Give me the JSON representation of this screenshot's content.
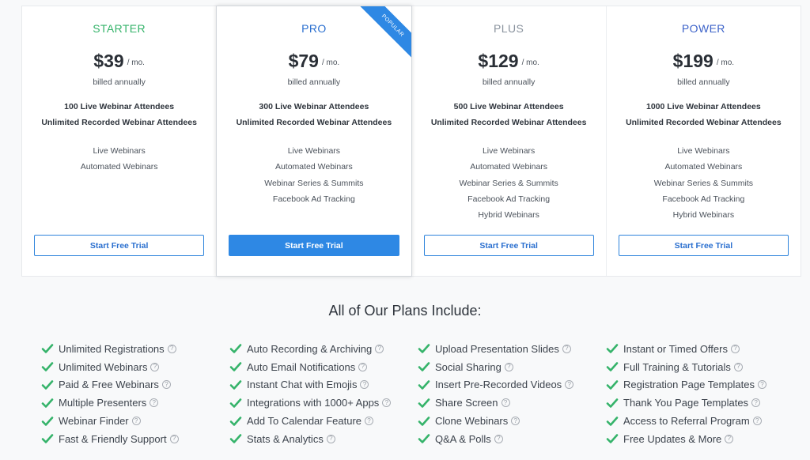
{
  "colors": {
    "accent": "#2e88e4",
    "check": "#35b36a",
    "starter": "#35b36a",
    "pro": "#2a6fcf",
    "plus": "#8a939e",
    "power": "#3d63c9"
  },
  "plans": [
    {
      "name": "STARTER",
      "price": "$39",
      "period": "/ mo.",
      "billing": "billed annually",
      "attendees": [
        "100 Live Webinar Attendees",
        "Unlimited Recorded Webinar Attendees"
      ],
      "features": [
        "Live Webinars",
        "Automated Webinars"
      ],
      "cta": "Start Free Trial"
    },
    {
      "name": "PRO",
      "badge": "POPULAR",
      "price": "$79",
      "period": "/ mo.",
      "billing": "billed annually",
      "attendees": [
        "300 Live Webinar Attendees",
        "Unlimited Recorded Webinar Attendees"
      ],
      "features": [
        "Live Webinars",
        "Automated Webinars",
        "Webinar Series & Summits",
        "Facebook Ad Tracking"
      ],
      "cta": "Start Free Trial"
    },
    {
      "name": "PLUS",
      "price": "$129",
      "period": "/ mo.",
      "billing": "billed annually",
      "attendees": [
        "500 Live Webinar Attendees",
        "Unlimited Recorded Webinar Attendees"
      ],
      "features": [
        "Live Webinars",
        "Automated Webinars",
        "Webinar Series & Summits",
        "Facebook Ad Tracking",
        "Hybrid Webinars"
      ],
      "cta": "Start Free Trial"
    },
    {
      "name": "POWER",
      "price": "$199",
      "period": "/ mo.",
      "billing": "billed annually",
      "attendees": [
        "1000 Live Webinar Attendees",
        "Unlimited Recorded Webinar Attendees"
      ],
      "features": [
        "Live Webinars",
        "Automated Webinars",
        "Webinar Series & Summits",
        "Facebook Ad Tracking",
        "Hybrid Webinars"
      ],
      "cta": "Start Free Trial"
    }
  ],
  "includes": {
    "title": "All of Our Plans Include:",
    "help_icon": "?",
    "columns": [
      [
        "Unlimited Registrations",
        "Unlimited Webinars",
        "Paid & Free Webinars",
        "Multiple Presenters",
        "Webinar Finder",
        "Fast & Friendly Support"
      ],
      [
        "Auto Recording & Archiving",
        "Auto Email Notifications",
        "Instant Chat with Emojis",
        "Integrations with 1000+ Apps",
        "Add To Calendar Feature",
        "Stats & Analytics"
      ],
      [
        "Upload Presentation Slides",
        "Social Sharing",
        "Insert Pre-Recorded Videos",
        "Share Screen",
        "Clone Webinars",
        "Q&A & Polls"
      ],
      [
        "Instant or Timed Offers",
        "Full Training & Tutorials",
        "Registration Page Templates",
        "Thank You Page Templates",
        "Access to Referral Program",
        "Free Updates & More"
      ]
    ]
  }
}
